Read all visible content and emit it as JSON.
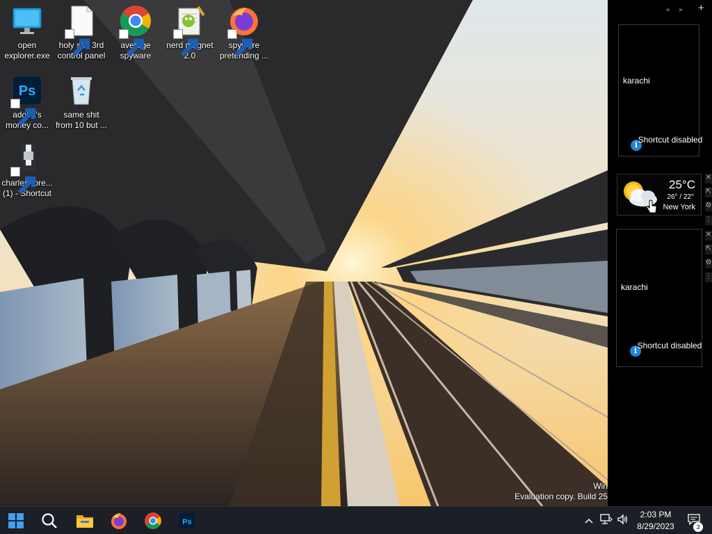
{
  "desktop": {
    "icons": [
      {
        "label": "open explorer.exe",
        "icon": "monitor-icon"
      },
      {
        "label": "holy shit 3rd control panel",
        "icon": "blank-document-icon"
      },
      {
        "label": "average spyware",
        "icon": "chrome-icon"
      },
      {
        "label": "nerd magnet 2.0",
        "icon": "notepad-plus-plus-icon"
      },
      {
        "label": "spyware pretending ...",
        "icon": "firefox-icon"
      },
      {
        "label": "adobe's money co...",
        "icon": "photoshop-icon"
      },
      {
        "label": "same shit from 10 but ...",
        "icon": "recycle-bin-icon"
      },
      {
        "label": "charles-fore... (1) - Shortcut",
        "icon": "image-thumbnail-icon"
      }
    ]
  },
  "sidebar": {
    "gadgets": [
      {
        "city": "karachi",
        "notice": "Shortcut disabled"
      },
      {
        "city": "karachi",
        "notice": "Shortcut disabled"
      }
    ],
    "weather": {
      "temperature": "25°C",
      "range": "26° / 22°",
      "location": "New York",
      "icon": "partly-cloudy-icon"
    },
    "controls": {
      "prev": "◂",
      "next": "▸",
      "add": "+"
    }
  },
  "watermark": {
    "line1": "Win",
    "line2": "Evaluation copy. Build 25"
  },
  "taskbar": {
    "apps": [
      "start-icon",
      "search-icon",
      "file-explorer-icon",
      "firefox-icon",
      "chrome-icon",
      "photoshop-icon"
    ],
    "clock": {
      "time": "2:03 PM",
      "date": "8/29/2023"
    },
    "notifications": "3"
  },
  "colors": {
    "taskbar": "#1c1f26",
    "sidebar": "#000000",
    "accent": "#1f86d6"
  }
}
